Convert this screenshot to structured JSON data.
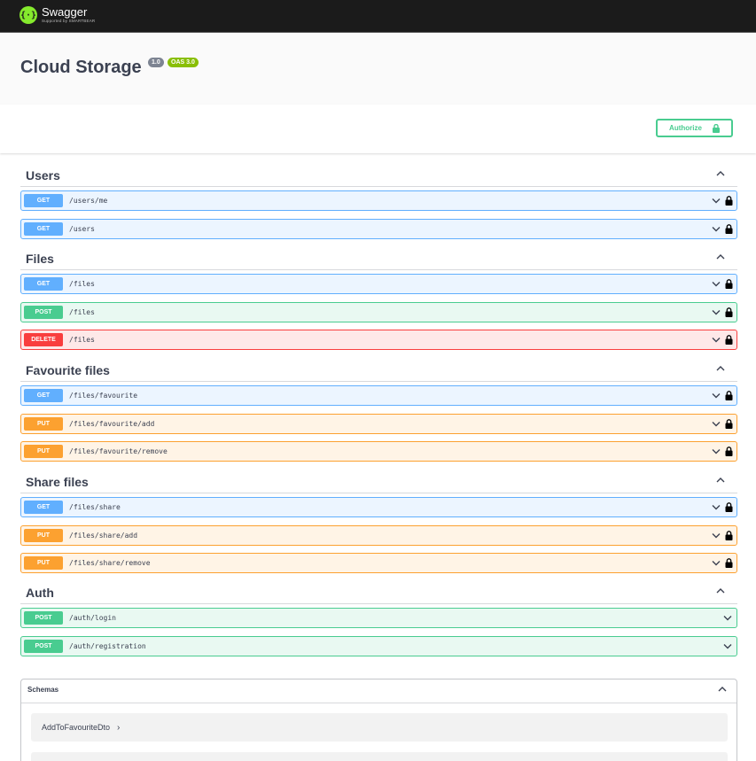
{
  "topbar": {
    "logo_title": "Swagger",
    "logo_sub": "Supported by SMARTBEAR",
    "logo_icon": "swagger-braces-icon"
  },
  "info": {
    "title": "Cloud Storage",
    "version": "1.0",
    "oas": "OAS 3.0"
  },
  "auth": {
    "label": "Authorize",
    "icon": "lock-icon"
  },
  "colors": {
    "get": "#61affe",
    "post": "#49cc90",
    "put": "#fca130",
    "delete": "#f93e3e",
    "brand": "#85ea2d"
  },
  "tags": [
    {
      "name": "Users",
      "ops": [
        {
          "method": "GET",
          "path": "/users/me",
          "locked": true
        },
        {
          "method": "GET",
          "path": "/users",
          "locked": true
        }
      ]
    },
    {
      "name": "Files",
      "ops": [
        {
          "method": "GET",
          "path": "/files",
          "locked": true
        },
        {
          "method": "POST",
          "path": "/files",
          "locked": true
        },
        {
          "method": "DELETE",
          "path": "/files",
          "locked": true
        }
      ]
    },
    {
      "name": "Favourite files",
      "ops": [
        {
          "method": "GET",
          "path": "/files/favourite",
          "locked": true
        },
        {
          "method": "PUT",
          "path": "/files/favourite/add",
          "locked": true
        },
        {
          "method": "PUT",
          "path": "/files/favourite/remove",
          "locked": true
        }
      ]
    },
    {
      "name": "Share files",
      "ops": [
        {
          "method": "GET",
          "path": "/files/share",
          "locked": true
        },
        {
          "method": "PUT",
          "path": "/files/share/add",
          "locked": true
        },
        {
          "method": "PUT",
          "path": "/files/share/remove",
          "locked": true
        }
      ]
    },
    {
      "name": "Auth",
      "ops": [
        {
          "method": "POST",
          "path": "/auth/login",
          "locked": false
        },
        {
          "method": "POST",
          "path": "/auth/registration",
          "locked": false
        }
      ]
    }
  ],
  "schemas": {
    "title": "Schemas",
    "models": [
      "AddToFavouriteDto"
    ]
  }
}
